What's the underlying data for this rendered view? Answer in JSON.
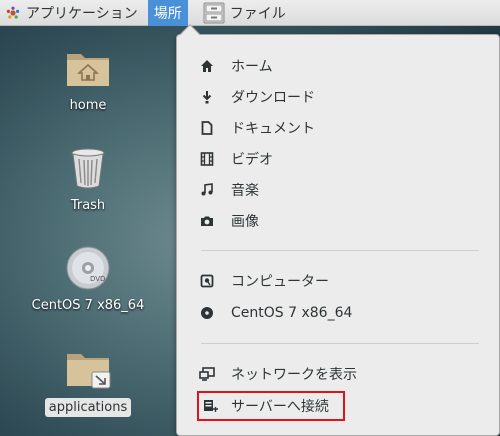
{
  "topbar": {
    "applications": "アプリケーション",
    "places": "場所",
    "files": "ファイル"
  },
  "desktop": {
    "home": "home",
    "trash": "Trash",
    "centos": "CentOS 7 x86_64",
    "applications": "applications"
  },
  "places_menu": {
    "home": "ホーム",
    "downloads": "ダウンロード",
    "documents": "ドキュメント",
    "videos": "ビデオ",
    "music": "音楽",
    "pictures": "画像",
    "computer": "コンピューター",
    "centos_disc": "CentOS 7 x86_64",
    "browse_network": "ネットワークを表示",
    "connect_to_server": "サーバーへ接続"
  },
  "colors": {
    "highlight": "#4a90d9",
    "red_box": "#e0131a"
  }
}
